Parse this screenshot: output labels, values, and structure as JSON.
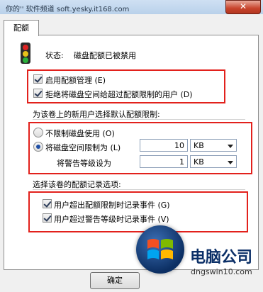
{
  "watermark": "你的'' 软件频道 soft.yesky.it168.com",
  "window": {
    "close_label": "✕"
  },
  "tab": {
    "label": "配额"
  },
  "status": {
    "label": "状态:",
    "value": "磁盘配额已被禁用"
  },
  "options": {
    "enable_quota": "启用配额管理 (E)",
    "deny_over_limit": "拒绝将磁盘空间给超过配额限制的用户 (D)"
  },
  "default_limit": {
    "heading": "为该卷上的新用户选择默认配额限制:",
    "no_limit": "不限制磁盘使用 (O)",
    "limit_to": "将磁盘空间限制为 (L)",
    "warning_level": "将警告等级设为",
    "limit_value": "10",
    "limit_unit": "KB",
    "warning_value": "1",
    "warning_unit": "KB"
  },
  "logging": {
    "heading": "选择该卷的配额记录选项:",
    "log_over_limit": "用户超出配额限制时记录事件 (G)",
    "log_over_warning": "用户超过警告等级时记录事件 (V)"
  },
  "buttons": {
    "ok": "确定"
  },
  "brand": {
    "name": "电脑公司",
    "url": "dngswin10.com"
  },
  "colors": {
    "highlight_box": "#e2211c"
  }
}
